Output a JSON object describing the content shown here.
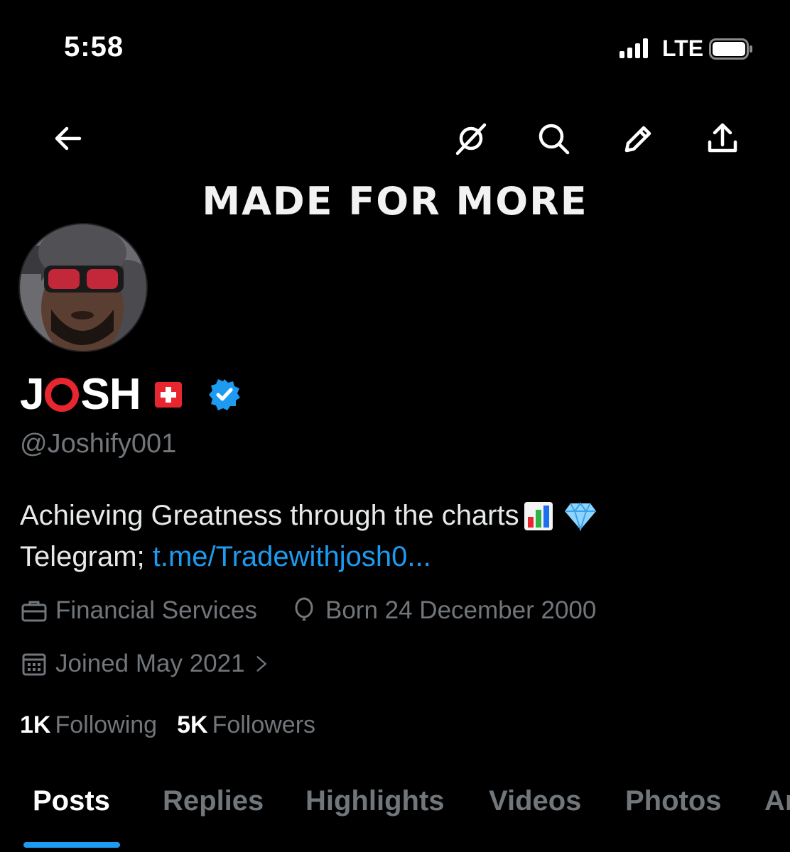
{
  "status_bar": {
    "time": "5:58",
    "network": "LTE"
  },
  "nav": {
    "back_icon": "arrow-left-icon",
    "icons": [
      "grok-slash-icon",
      "search-icon",
      "edit-pencil-icon",
      "share-upload-icon"
    ]
  },
  "banner": {
    "text": "MADE FOR MORE"
  },
  "profile": {
    "name_prefix": "J",
    "name_suffix": "SH",
    "flag": "swiss-flag-icon",
    "verified": true,
    "handle": "@Joshify001",
    "bio_line1": "Achieving Greatness through the charts",
    "bio_line2_prefix": "Telegram; ",
    "bio_link": "t.me/Tradewithjosh0...",
    "category": "Financial Services",
    "birthday": "Born 24 December 2000",
    "joined": "Joined May 2021",
    "following_count": "1K",
    "following_label": "Following",
    "followers_count": "5K",
    "followers_label": "Followers"
  },
  "tabs": [
    {
      "label": "Posts",
      "active": true
    },
    {
      "label": "Replies",
      "active": false
    },
    {
      "label": "Highlights",
      "active": false
    },
    {
      "label": "Videos",
      "active": false
    },
    {
      "label": "Photos",
      "active": false
    },
    {
      "label": "Ar",
      "active": false
    }
  ],
  "colors": {
    "accent": "#1d9bf0",
    "muted": "#71767b",
    "background": "#000000"
  }
}
